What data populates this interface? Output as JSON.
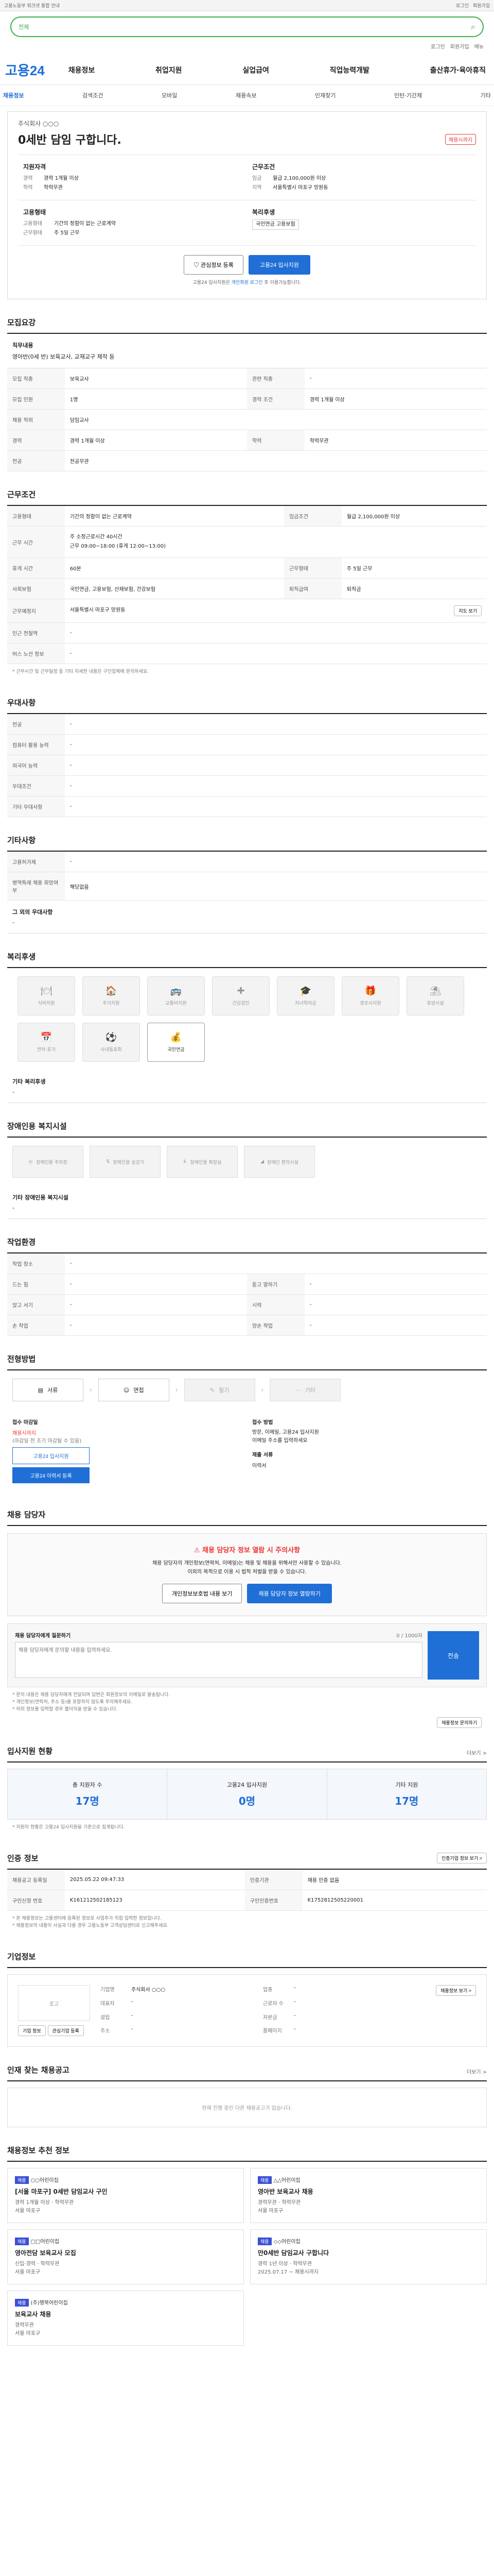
{
  "topbar": {
    "left": "고용노동부 워크넷 통합 안내",
    "right1": "로그인",
    "right2": "회원가입"
  },
  "search": {
    "scope": "전체",
    "placeholder": ""
  },
  "util": {
    "a": "로그인",
    "b": "회원가입",
    "c": "메뉴"
  },
  "gnb": {
    "logo": "고용24",
    "menu": [
      "채용정보",
      "취업지원",
      "실업급여",
      "직업능력개발",
      "출산휴가·육아휴직"
    ]
  },
  "subnav": [
    "채용정보",
    "검색조건",
    "모바일",
    "채용속보",
    "인재찾기",
    "인턴·기간제",
    "기타"
  ],
  "summary": {
    "company": "주식회사 ○○○",
    "title": "0세반 담임 구합니다.",
    "dday": "채용시까지",
    "cells": [
      {
        "h": "지원자격",
        "rows": [
          [
            "경력",
            "경력 1개월 이상"
          ],
          [
            "학력",
            "학력무관"
          ]
        ]
      },
      {
        "h": "근무조건",
        "rows": [
          [
            "임금",
            "월급 2,100,000원 이상"
          ],
          [
            "지역",
            "서울특별시 마포구 망원동"
          ]
        ]
      },
      {
        "h": "고용형태",
        "rows": [
          [
            "고용형태",
            "기간의 정함이 없는 근로계약"
          ],
          [
            "근무형태",
            "주 5일 근무"
          ]
        ]
      },
      {
        "h": "복리후생",
        "rows": [
          [
            "",
            "국민연금 고용보험"
          ]
        ]
      }
    ]
  },
  "actions": {
    "favorite": "관심정보 등록",
    "apply": "고용24 입사지원"
  },
  "notice": {
    "pre": "고용24 입사지원은 ",
    "link": "개인회원 로그인",
    "post": " 후 이용가능합니다."
  },
  "recruit": {
    "heading": "모집요강",
    "jobTitle": "직무내용",
    "jobDesc": "영아반(0세 반) 보육교사, 교재교구 제작 등",
    "rows": [
      [
        "모집 직종",
        "보육교사",
        "관련 직종",
        "-"
      ],
      [
        "모집 인원",
        "1명",
        "경력 조건",
        "경력 1개월 이상"
      ],
      [
        "채용 직위",
        "담임교사",
        "",
        ""
      ],
      [
        "경력",
        "경력 1개월 이상",
        "학력",
        "학력무관"
      ],
      [
        "전공",
        "전공무관",
        "",
        ""
      ]
    ]
  },
  "condition": {
    "heading": "근무조건",
    "rows": [
      [
        "고용형태",
        "기간의 정함이 없는 근로계약",
        "임금조건",
        "월급 2,100,000원 이상"
      ],
      [
        "근무 시간",
        "주 소정근로시간 40시간\n근무 09:00~18:00 (휴게 12:00~13:00)",
        "",
        " "
      ],
      [
        "휴게 시간",
        "60분",
        "근무형태",
        "주 5일 근무"
      ],
      [
        "사회보험",
        "국민연금, 고용보험, 산재보험, 건강보험",
        "퇴직급여",
        "퇴직금"
      ],
      [
        "근무예정지",
        "서울특별시 마포구 망원동",
        "",
        ""
      ],
      [
        "인근 전철역",
        "-",
        "",
        ""
      ],
      [
        "버스 노선 정보",
        "-",
        "",
        ""
      ]
    ],
    "mapBtn": "지도 보기",
    "note": "* 근무시간 및 근무일정 등 기타 자세한 내용은 구인업체에 문의하세요."
  },
  "prefer": {
    "heading": "우대사항",
    "rows": [
      [
        "전공",
        "-"
      ],
      [
        "컴퓨터 활용 능력",
        "-"
      ],
      [
        "외국어 능력",
        "-"
      ],
      [
        "우대조건",
        "-"
      ],
      [
        "기타 우대사항",
        "-"
      ]
    ]
  },
  "etc": {
    "heading": "기타사항",
    "rows": [
      [
        "고용허가제",
        "-"
      ],
      [
        "병역특례 채용 희망여부",
        "해당없음"
      ]
    ],
    "othersLabel": "그 외의 우대사항",
    "othersValue": "-"
  },
  "welfare": {
    "heading": "복리후생",
    "items": [
      {
        "label": "식비지원",
        "icon": "🍽",
        "on": false
      },
      {
        "label": "주거지원",
        "icon": "🏠",
        "on": false
      },
      {
        "label": "교통비지원",
        "icon": "🚌",
        "on": false
      },
      {
        "label": "건강검진",
        "icon": "✚",
        "on": false
      },
      {
        "label": "자녀학자금",
        "icon": "🎓",
        "on": false
      },
      {
        "label": "경조사지원",
        "icon": "🎁",
        "on": false
      },
      {
        "label": "휴양시설",
        "icon": "⛱",
        "on": false
      },
      {
        "label": "연차·휴가",
        "icon": "📅",
        "on": false
      },
      {
        "label": "사내동호회",
        "icon": "⚽",
        "on": false
      },
      {
        "label": "국민연금",
        "icon": "💰",
        "on": true
      }
    ],
    "etcLabel": "기타 복리후생",
    "etcValue": "-"
  },
  "disability": {
    "heading": "장애인용 복지시설",
    "items": [
      "장애인용 주차장",
      "장애인용 승강기",
      "장애인용 화장실",
      "장애인 편의시설"
    ],
    "etcLabel": "기타 장애인용 복지시설",
    "etcValue": "-"
  },
  "env": {
    "heading": "작업환경",
    "rows": [
      [
        "작업 장소",
        "-",
        "",
        ""
      ],
      [
        "드는 힘",
        "-",
        "듣고 말하기",
        "-"
      ],
      [
        "앉고 서기",
        "-",
        "시력",
        "-"
      ],
      [
        "손 작업",
        "-",
        "양손 작업",
        "-"
      ]
    ]
  },
  "process": {
    "heading": "전형방법",
    "steps": [
      {
        "label": "서류",
        "off": false
      },
      {
        "label": "면접",
        "off": false
      },
      {
        "label": "필기",
        "off": true
      },
      {
        "label": "기타",
        "off": true
      }
    ],
    "applyTitle": "접수 마감일",
    "applyValue": "채용시까지",
    "applyNote": "(마감일 전 조기 마감될 수 있음)",
    "docTitle": "접수 방법",
    "docValue": "방문, 이메일, 고용24 입사지원\n이메일 주소를 입력하세요",
    "submitTitle": "제출 서류",
    "submitValue": "이력서",
    "btnLine": "고용24 입사지원",
    "btnFill": "고용24 이력서 등록"
  },
  "manager": {
    "heading": "채용 담당자",
    "warnTitle": "채용 담당자 정보 열람 시 주의사항",
    "warnText": "채용 담당자의 개인정보(연락처, 이메일)는 채용 및 채용을 위해서만 사용할 수 있습니다.\n이외의 목적으로 이용 시 법적 처벌을 받을 수 있습니다.",
    "btn1": "개인정보보호법 내용 보기",
    "btn2": "채용 담당자 정보 열람하기",
    "inqTitle": "채용 담당자에게 질문하기",
    "inqCount": "0 / 1000자",
    "inqPh": "채용 담당자에게 문의할 내용을 입력하세요.",
    "inqBtn": "전송",
    "notes": "* 문의 내용은 채용 담당자에게 전달되며 답변은 회원정보의 이메일로 발송됩니다.\n* 개인정보(연락처, 주소 등)를 포함하지 않도록 주의해주세요.\n* 허위 정보를 입력할 경우 불이익을 받을 수 있습니다.",
    "qaBtn": "채용정보 문의하기"
  },
  "applicants": {
    "heading": "입사지원 현황",
    "more": "더보기 >",
    "cells": [
      {
        "label": "총 지원자 수",
        "n": "17명"
      },
      {
        "label": "고용24 입사지원",
        "n": "0명"
      },
      {
        "label": "기타 지원",
        "n": "17명"
      }
    ],
    "note": "* 지원자 현황은 고용24 입사지원을 기준으로 집계됩니다."
  },
  "reginfo": {
    "heading": "인증 정보",
    "btn": "인증기업 정보 보기 >",
    "rows": [
      [
        "채용공고 등록일",
        "2025.05.22 09:47:33",
        "인증기관",
        "채용 인증 없음"
      ],
      [
        "구인신청 번호",
        "K161212502185123",
        "구인인증번호",
        "K1752812505220001"
      ]
    ],
    "notes": "* 본 채용정보는 고용센터에 등록된 정보로 사업주가 직접 입력한 정보입니다.\n* 채용정보의 내용이 사실과 다를 경우 고용노동부 고객상담센터로 신고해주세요."
  },
  "company": {
    "heading": "기업정보",
    "logo": "로고",
    "rows": [
      [
        "기업명",
        "주식회사 ○○○",
        "업종",
        "-"
      ],
      [
        "대표자",
        "-",
        "근로자 수",
        "-"
      ],
      [
        "설립",
        "-",
        "자본금",
        "-"
      ],
      [
        "주소",
        "-",
        "홈페이지",
        "-"
      ]
    ],
    "btn1": "기업 정보",
    "btn2": "관심기업 등록",
    "btn3": "채용정보 보기 >"
  },
  "others": {
    "heading": "인재 찾는 채용공고",
    "note": "현재 진행 중인 다른 채용공고가 없습니다.",
    "more": "더보기 >"
  },
  "similar": {
    "heading": "채용정보 추천 정보",
    "cards": [
      {
        "tag": "채용",
        "org": "○○어린이집",
        "title": "[서울 마포구] 0세반 담임교사 구인",
        "meta": "경력 1개월 이상 · 학력무관\n서울 마포구"
      },
      {
        "tag": "채용",
        "org": "△△어린이집",
        "title": "영아반 보육교사 채용",
        "meta": "경력무관 · 학력무관\n서울 마포구"
      },
      {
        "tag": "채용",
        "org": "□□어린이집",
        "title": "영아전담 보육교사 모집",
        "meta": "신입·경력 · 학력무관\n서울 마포구"
      },
      {
        "tag": "채용",
        "org": "◇◇어린이집",
        "title": "만0세반 담임교사 구합니다",
        "meta": "경력 1년 이상 · 학력무관\n2025.07.17 ~ 채용시까지"
      },
      {
        "tag": "채용",
        "org": "(주)행복어린이집",
        "title": "보육교사 채용",
        "meta": "경력무관\n서울 마포구"
      }
    ]
  }
}
